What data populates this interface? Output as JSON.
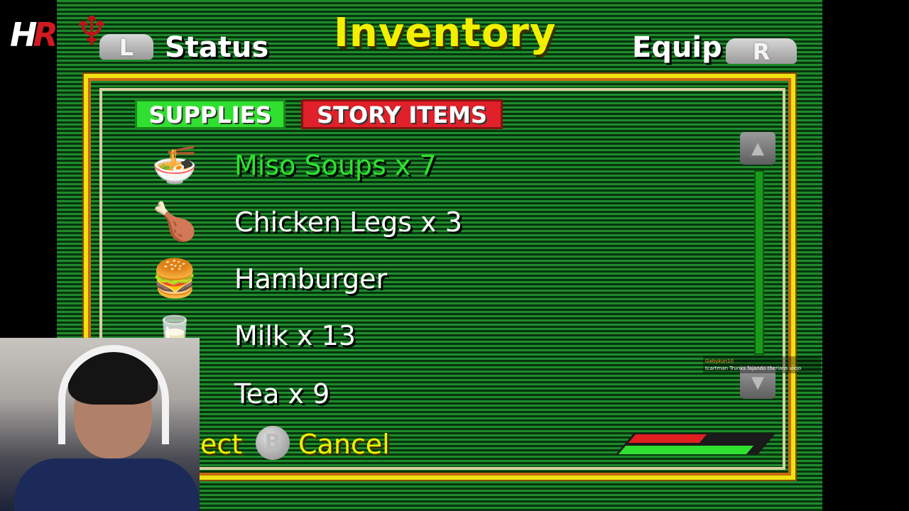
{
  "header": {
    "title": "Inventory",
    "left_tab": "Status",
    "right_tab": "Equip",
    "left_shoulder": "L",
    "right_shoulder": "R"
  },
  "channel_logo": {
    "text_white": "H",
    "text_red": "R",
    "crest": "liver-bird"
  },
  "tabs": [
    {
      "label": "SUPPLIES",
      "active": true,
      "color": "#30e030"
    },
    {
      "label": "STORY ITEMS",
      "active": false,
      "color": "#e0202a"
    }
  ],
  "items": [
    {
      "label": "Miso Soups x 7",
      "icon": "miso-soup-icon",
      "selected": true
    },
    {
      "label": "Chicken Legs x 3",
      "icon": "chicken-leg-icon",
      "selected": false
    },
    {
      "label": "Hamburger",
      "icon": "hamburger-icon",
      "selected": false
    },
    {
      "label": "Milk x 13",
      "icon": "milk-icon",
      "selected": false
    },
    {
      "label": "Tea x 9",
      "icon": "tea-icon",
      "selected": false
    }
  ],
  "footer": {
    "select_hint": "ect",
    "b_button": "B",
    "cancel_hint": "Cancel"
  },
  "chat": {
    "user": "Gabykun10",
    "message": "tcartman Trunks fajando therians viejo"
  },
  "colors": {
    "title": "#f2f000",
    "frame": "#f0e010",
    "background": "#1f8a2c",
    "selected_item": "#30e030"
  }
}
